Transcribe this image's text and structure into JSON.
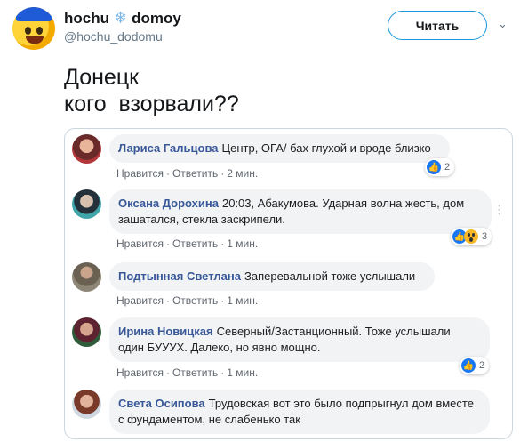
{
  "tweet": {
    "display_name": "hochu",
    "display_name_suffix": "domoy",
    "snowflake_icon": "❄",
    "handle": "@hochu_dodomu",
    "follow_label": "Читать",
    "text": "Донецк\nкого  взорвали??"
  },
  "colors": {
    "link": "#385898",
    "bubble": "#f2f3f5",
    "twitter_blue": "#1b95e0",
    "fb_like": "#1877f2"
  },
  "comments": [
    {
      "author": "Лариса Гальцова",
      "text": "Центр, ОГА/ бах глухой и вроде близко",
      "like": "Нравится",
      "reply": "Ответить",
      "time": "2 мин.",
      "reaction_count": "2"
    },
    {
      "author": "Оксана Дорохина",
      "text": "20:03, Абакумова. Ударная волна жесть, дом зашатался, стекла заскрипели.",
      "like": "Нравится",
      "reply": "Ответить",
      "time": "1 мин.",
      "reaction_count": "3"
    },
    {
      "author": "Подтынная Светлана",
      "text": "Заперевальной тоже услышали",
      "like": "Нравится",
      "reply": "Ответить",
      "time": "1 мин."
    },
    {
      "author": "Ирина Новицкая",
      "text": "Северный/Застанционный. Тоже услышали один БУУУХ. Далеко, но явно мощно.",
      "like": "Нравится",
      "reply": "Ответить",
      "time": "1 мин.",
      "reaction_count": "2"
    },
    {
      "author": "Света Осипова",
      "text": "Трудовская вот это было подпрыгнул дом вместе с фундаментом, не слабенько так"
    }
  ]
}
